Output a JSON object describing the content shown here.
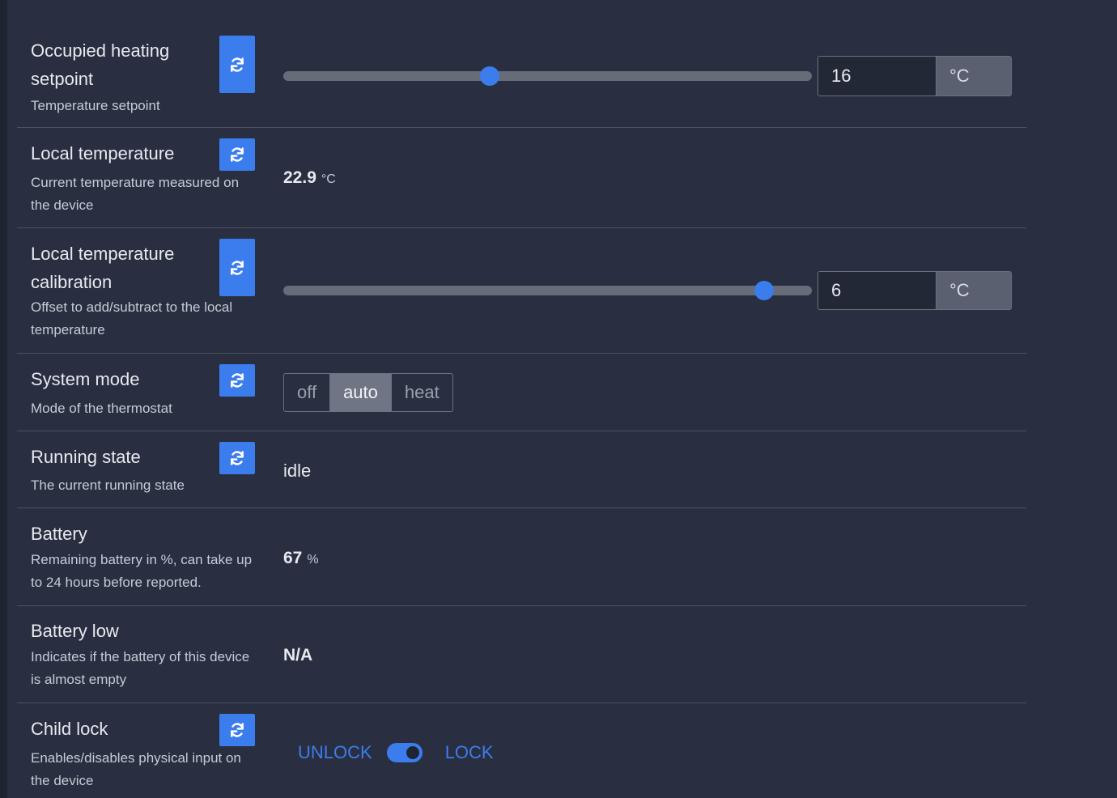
{
  "rows": [
    {
      "title": "Occupied heating setpoint",
      "description": "Temperature setpoint",
      "control": "slider",
      "value": "16",
      "unit": "°C",
      "slider_fraction": 0.39
    },
    {
      "title": "Local temperature",
      "description": "Current temperature measured on the device",
      "control": "value",
      "value": "22.9",
      "unit": "°C"
    },
    {
      "title": "Local temperature calibration",
      "description": "Offset to add/subtract to the local temperature",
      "control": "slider",
      "value": "6",
      "unit": "°C",
      "slider_fraction": 0.91
    },
    {
      "title": "System mode",
      "description": "Mode of the thermostat",
      "control": "mode",
      "options": [
        "off",
        "auto",
        "heat"
      ],
      "selected": "auto"
    },
    {
      "title": "Running state",
      "description": "The current running state",
      "control": "text",
      "value": "idle"
    },
    {
      "title": "Battery",
      "description": "Remaining battery in %, can take up to 24 hours before reported.",
      "control": "value",
      "value": "67",
      "unit": "%"
    },
    {
      "title": "Battery low",
      "description": "Indicates if the battery of this device is almost empty",
      "control": "value",
      "value": "N/A",
      "unit": ""
    },
    {
      "title": "Child lock",
      "description": "Enables/disables physical input on the device",
      "control": "toggle",
      "off_label": "UNLOCK",
      "on_label": "LOCK",
      "state": "on"
    }
  ],
  "icons": {
    "refresh": "refresh-icon"
  },
  "colors": {
    "accent": "#3b7ded",
    "background": "#292f40"
  }
}
